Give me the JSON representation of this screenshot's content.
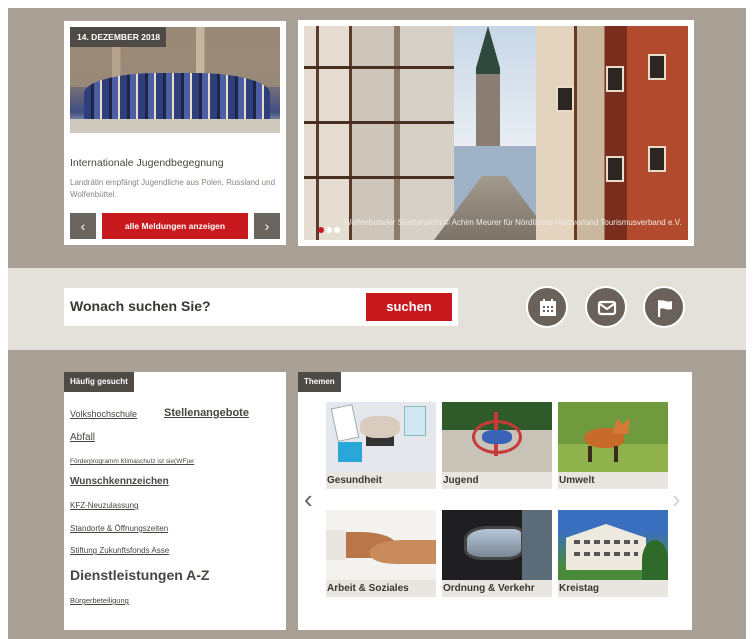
{
  "news": {
    "date": "14. DEZEMBER 2018",
    "title": "Internationale Jugendbegegnung",
    "text": "Landrätin empfängt Jugendliche aus Polen, Russland und Wolfenbüttel.",
    "prev": "‹",
    "next": "›",
    "all_label": "alle Meldungen anzeigen"
  },
  "hero": {
    "caption": "Wolfenbütteler Stadtansicht © Achim Meurer für Nördliches Harzvorland Tourismusverband e.V."
  },
  "search": {
    "label": "Wonach suchen Sie?",
    "button": "suchen"
  },
  "quick_icons": [
    "calendar-icon",
    "mail-icon",
    "flag-icon"
  ],
  "frequent": {
    "title": "Häufig gesucht",
    "items": [
      "Volkshochschule",
      "Stellenangebote",
      "Abfall",
      "Förderprogramm Klimaschutz ist sie(WF)er",
      "Wunschkennzeichen",
      "KFZ-Neuzulassung",
      "Standorte & Öffnungszeiten",
      "Stiftung Zukunftsfonds Asse",
      "Dienstleistungen A-Z",
      "Bürgerbeteiligung"
    ]
  },
  "topics": {
    "title": "Themen",
    "prev": "‹",
    "next": "›",
    "items": [
      "Gesundheit",
      "Jugend",
      "Umwelt",
      "Arbeit & Soziales",
      "Ordnung & Verkehr",
      "Kreistag"
    ]
  }
}
